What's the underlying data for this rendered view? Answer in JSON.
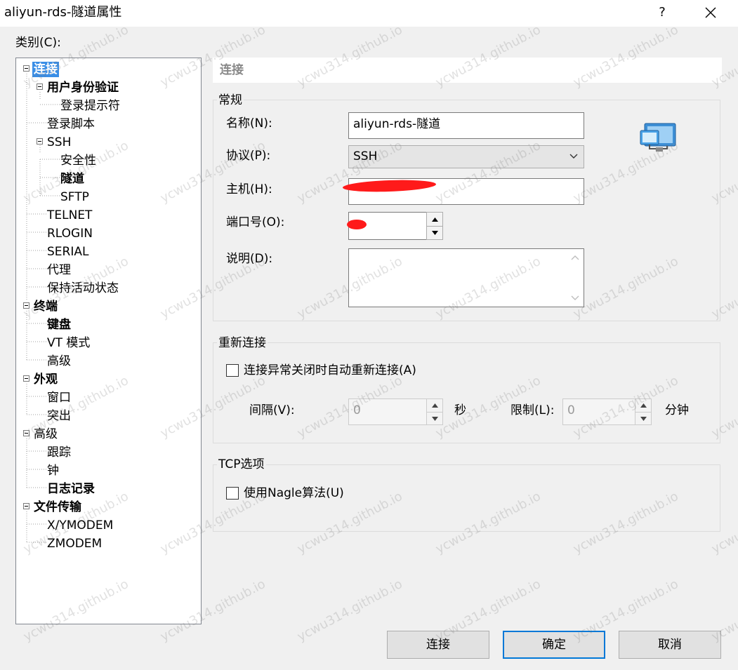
{
  "window": {
    "title": "aliyun-rds-隧道属性",
    "help_label": "?"
  },
  "category_label": "类别(C):",
  "tree": {
    "items": [
      {
        "label": "连接"
      },
      {
        "label": "用户身份验证"
      },
      {
        "label": "登录提示符"
      },
      {
        "label": "登录脚本"
      },
      {
        "label": "SSH"
      },
      {
        "label": "安全性"
      },
      {
        "label": "隧道"
      },
      {
        "label": "SFTP"
      },
      {
        "label": "TELNET"
      },
      {
        "label": "RLOGIN"
      },
      {
        "label": "SERIAL"
      },
      {
        "label": "代理"
      },
      {
        "label": "保持活动状态"
      },
      {
        "label": "终端"
      },
      {
        "label": "键盘"
      },
      {
        "label": "VT 模式"
      },
      {
        "label": "高级"
      },
      {
        "label": "外观"
      },
      {
        "label": "窗口"
      },
      {
        "label": "突出"
      },
      {
        "label": "高级"
      },
      {
        "label": "跟踪"
      },
      {
        "label": "钟"
      },
      {
        "label": "日志记录"
      },
      {
        "label": "文件传输"
      },
      {
        "label": "X/YMODEM"
      },
      {
        "label": "ZMODEM"
      }
    ]
  },
  "panel": {
    "title": "连接",
    "general": {
      "title": "常规",
      "name_label": "名称(N):",
      "name_value": "aliyun-rds-隧道",
      "protocol_label": "协议(P):",
      "protocol_value": "SSH",
      "host_label": "主机(H):",
      "port_label": "端口号(O):",
      "description_label": "说明(D):"
    },
    "reconnect": {
      "title": "重新连接",
      "checkbox_label": "连接异常关闭时自动重新连接(A)",
      "interval_label": "间隔(V):",
      "interval_value": "0",
      "interval_unit": "秒",
      "limit_label": "限制(L):",
      "limit_value": "0",
      "limit_unit": "分钟"
    },
    "tcp": {
      "title": "TCP选项",
      "nagle_label": "使用Nagle算法(U)"
    }
  },
  "buttons": {
    "connect": "连接",
    "ok": "确定",
    "cancel": "取消"
  },
  "watermark": "ycwu314.github.io"
}
